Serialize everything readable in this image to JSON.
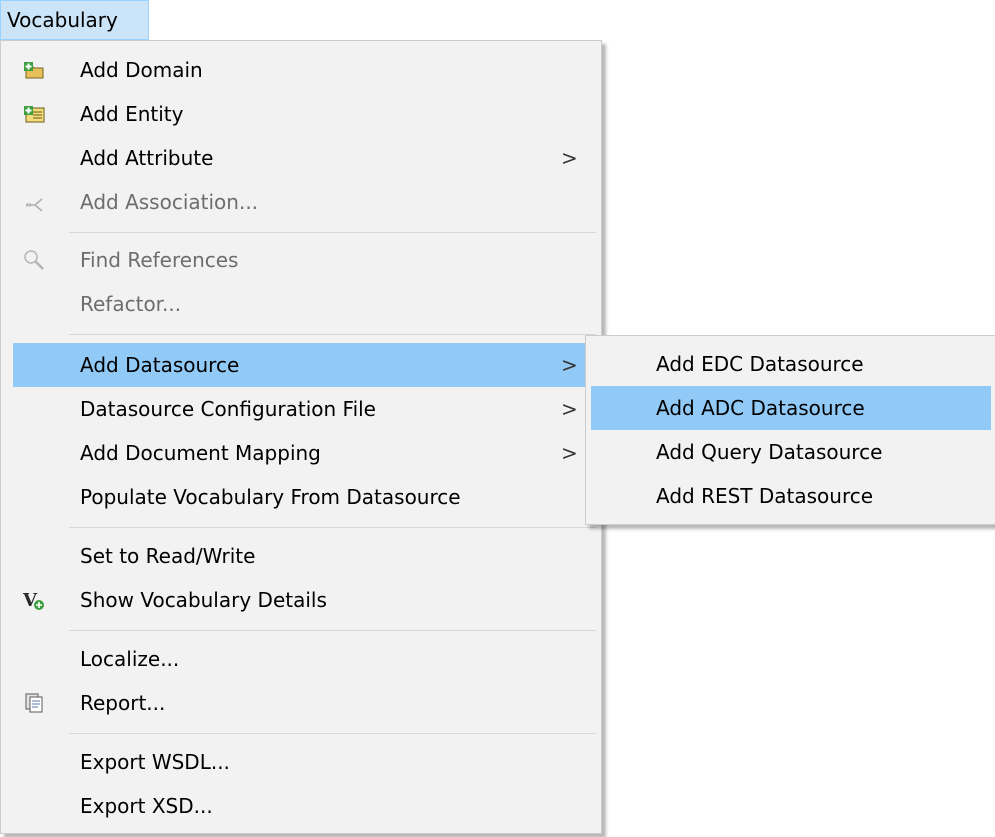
{
  "menubar": {
    "title": "Vocabulary"
  },
  "menu": {
    "items": [
      {
        "label": "Add Domain",
        "icon": "add-domain-icon"
      },
      {
        "label": "Add Entity",
        "icon": "add-entity-icon"
      },
      {
        "label": "Add Attribute",
        "arrow": ">"
      },
      {
        "label": "Add Association...",
        "icon": "association-icon",
        "disabled": true
      },
      {
        "label": "Find References",
        "icon": "search-icon",
        "disabled": true
      },
      {
        "label": "Refactor...",
        "disabled": true
      },
      {
        "label": "Add Datasource",
        "arrow": ">",
        "highlighted": true
      },
      {
        "label": "Datasource Configuration File",
        "arrow": ">"
      },
      {
        "label": "Add Document Mapping",
        "arrow": ">"
      },
      {
        "label": "Populate Vocabulary From Datasource"
      },
      {
        "label": "Set to Read/Write"
      },
      {
        "label": "Show Vocabulary Details",
        "icon": "vocabulary-details-icon"
      },
      {
        "label": "Localize..."
      },
      {
        "label": "Report...",
        "icon": "report-icon"
      },
      {
        "label": "Export WSDL..."
      },
      {
        "label": "Export XSD..."
      }
    ]
  },
  "submenu": {
    "items": [
      {
        "label": "Add EDC Datasource"
      },
      {
        "label": "Add ADC Datasource",
        "highlighted": true
      },
      {
        "label": "Add Query Datasource"
      },
      {
        "label": "Add REST Datasource"
      }
    ]
  },
  "colors": {
    "highlight": "#91c9f7",
    "menu_bg": "#f2f2f2",
    "menubar_bg": "#cce4f7",
    "disabled_text": "#6d6d6d"
  }
}
